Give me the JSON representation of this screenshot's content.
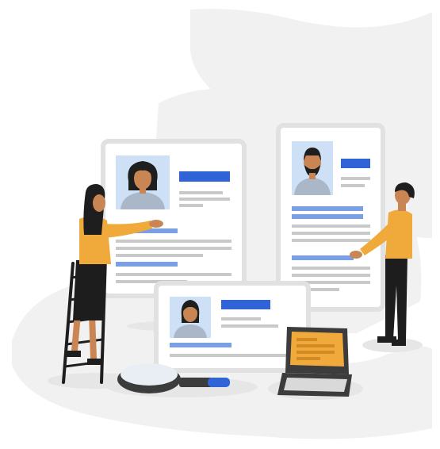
{
  "palette": {
    "blob": "#f1f1f1",
    "ground": "#e6e6e6",
    "card": "#ffffff",
    "card_border": "#e1e1e1",
    "photo_bg": "#cde0f5",
    "accent_blue": "#2f63d6",
    "light_blue": "#7b9fe3",
    "grey_line": "#c9c9c9",
    "shirt": "#f0a93b",
    "skin": "#c98654",
    "hair": "#1e1e1e",
    "pants": "#1d1d1d",
    "suit": "#a9b7c8",
    "laptop_screen": "#f0a93b",
    "laptop_body": "#3c3c3c"
  },
  "illustration": {
    "subject": "resume-review",
    "icons": [
      "resume-card-icon",
      "magnifier-icon",
      "laptop-icon",
      "ladder-icon"
    ]
  }
}
